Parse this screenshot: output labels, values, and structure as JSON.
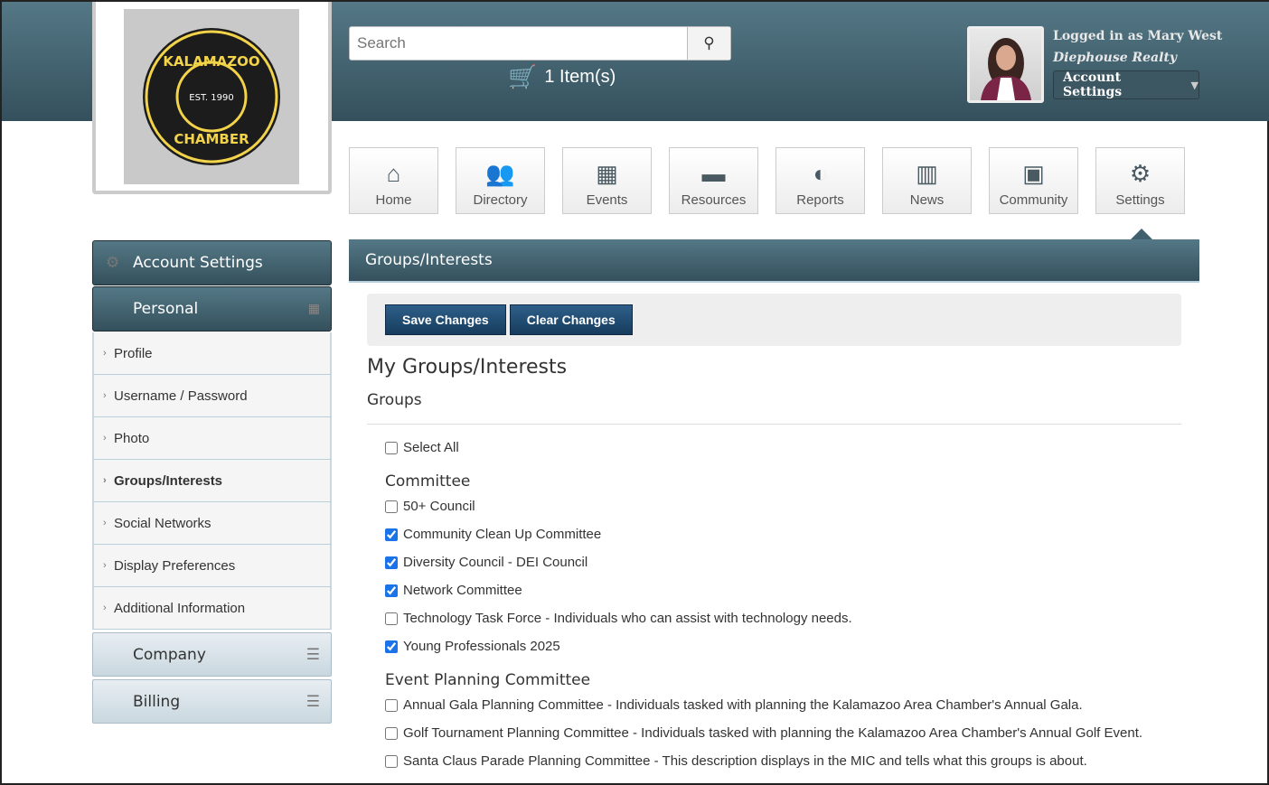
{
  "header": {
    "logo": {
      "top": "KALAMAZOO",
      "est": "EST. 1990",
      "bottom": "CHAMBER"
    },
    "search_placeholder": "Search",
    "cart": "1 Item(s)",
    "logged_in": "Logged in as Mary West",
    "company": "Diephouse Realty",
    "account_button": "Account Settings"
  },
  "nav": [
    {
      "label": "Home",
      "icon": "⌂"
    },
    {
      "label": "Directory",
      "icon": "👥"
    },
    {
      "label": "Events",
      "icon": "▦"
    },
    {
      "label": "Resources",
      "icon": "▬"
    },
    {
      "label": "Reports",
      "icon": "◐"
    },
    {
      "label": "News",
      "icon": "▥"
    },
    {
      "label": "Community",
      "icon": "▣"
    },
    {
      "label": "Settings",
      "icon": "⚙"
    }
  ],
  "sidebar": {
    "header": "Account Settings",
    "section": "Personal",
    "items": [
      "Profile",
      "Username / Password",
      "Photo",
      "Groups/Interests",
      "Social Networks",
      "Display Preferences",
      "Additional Information"
    ],
    "other_sections": [
      "Company",
      "Billing"
    ]
  },
  "panel": {
    "title": "Groups/Interests",
    "save": "Save Changes",
    "clear": "Clear Changes",
    "heading": "My Groups/Interests",
    "subheading": "Groups",
    "select_all": "Select All",
    "committee_title": "Committee",
    "committee": [
      {
        "label": "50+ Council",
        "checked": false
      },
      {
        "label": "Community Clean Up Committee",
        "checked": true
      },
      {
        "label": "Diversity Council - DEI Council",
        "checked": true
      },
      {
        "label": "Network Committee",
        "checked": true
      },
      {
        "label": "Technology Task Force - Individuals who can assist with technology needs.",
        "checked": false
      },
      {
        "label": "Young Professionals 2025",
        "checked": true
      }
    ],
    "event_title": "Event Planning Committee",
    "event": [
      {
        "label": "Annual Gala Planning Committee - Individuals tasked with planning the Kalamazoo Area Chamber's Annual Gala.",
        "checked": false
      },
      {
        "label": "Golf Tournament Planning Committee - Individuals tasked with planning the Kalamazoo Area Chamber's Annual Golf Event.",
        "checked": false
      },
      {
        "label": "Santa Claus Parade Planning Committee - This description displays in the MIC and tells what this groups is about.",
        "checked": false
      }
    ]
  }
}
